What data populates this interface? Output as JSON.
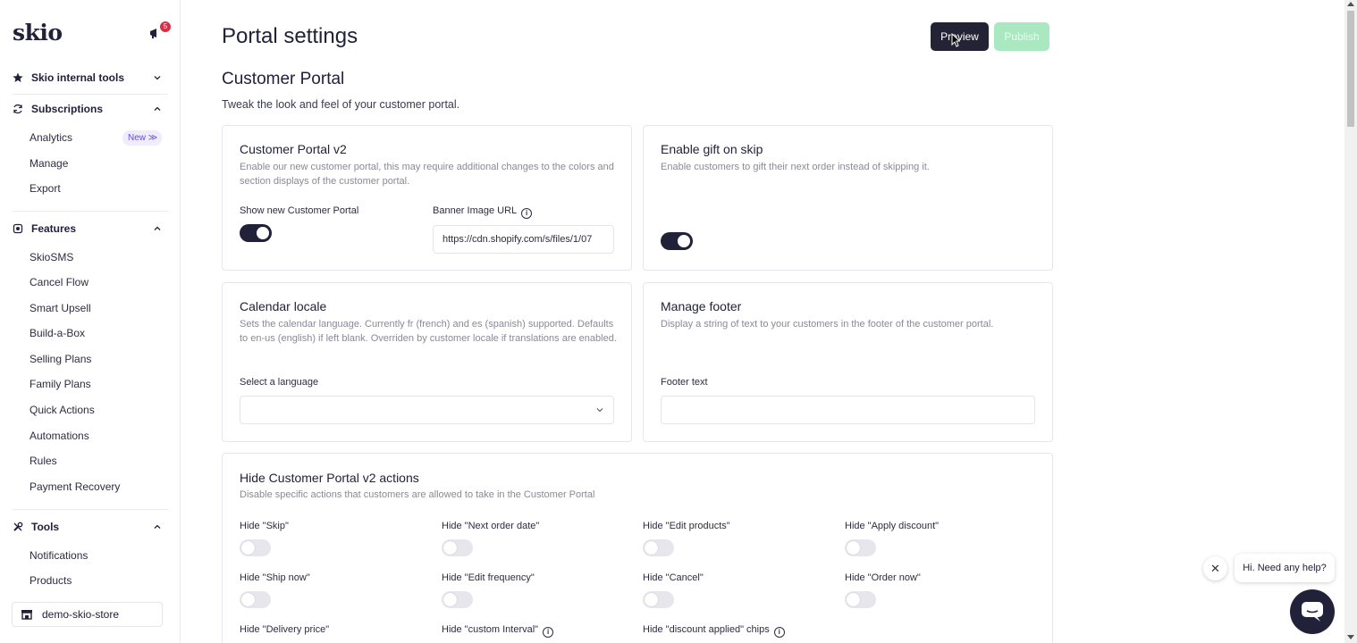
{
  "sidebar": {
    "logo": "skio",
    "notification_count": "5",
    "sections": [
      {
        "label": "Skio internal tools",
        "icon": "star-icon"
      },
      {
        "label": "Subscriptions",
        "icon": "refresh-icon"
      },
      {
        "label": "Features",
        "icon": "settings-icon"
      },
      {
        "label": "Tools",
        "icon": "tools-icon"
      }
    ],
    "subscriptions_items": [
      "Analytics",
      "Manage",
      "Export"
    ],
    "analytics_badge": "New",
    "features_items": [
      "SkioSMS",
      "Cancel Flow",
      "Smart Upsell",
      "Build-a-Box",
      "Selling Plans",
      "Family Plans",
      "Quick Actions",
      "Automations",
      "Rules",
      "Payment Recovery"
    ],
    "tools_items": [
      "Notifications",
      "Products"
    ],
    "store_name": "demo-skio-store"
  },
  "header": {
    "title": "Portal settings",
    "preview_label": "Preview",
    "publish_label": "Publish"
  },
  "portal": {
    "heading": "Customer Portal",
    "subheading": "Tweak the look and feel of your customer portal."
  },
  "cards": {
    "portal_v2": {
      "title": "Customer Portal v2",
      "desc": "Enable our new customer portal, this may require additional changes to the colors and section displays of the customer portal.",
      "toggle_label": "Show new Customer Portal",
      "banner_label": "Banner Image URL",
      "banner_value": "https://cdn.shopify.com/s/files/1/07"
    },
    "gift": {
      "title": "Enable gift on skip",
      "desc": "Enable customers to gift their next order instead of skipping it."
    },
    "calendar": {
      "title": "Calendar locale",
      "desc": "Sets the calendar language. Currently fr (french) and es (spanish) supported. Defaults to en-us (english) if left blank. Overriden by customer locale if translations are enabled.",
      "select_label": "Select a language",
      "select_value": ""
    },
    "footer": {
      "title": "Manage footer",
      "desc": "Display a string of text to your customers in the footer of the customer portal.",
      "field_label": "Footer text",
      "field_value": ""
    },
    "actions": {
      "title": "Hide Customer Portal v2 actions",
      "desc": "Disable specific actions that customers are allowed to take in the Customer Portal",
      "items": [
        "Hide \"Skip\"",
        "Hide \"Next order date\"",
        "Hide \"Edit products\"",
        "Hide \"Apply discount\"",
        "Hide \"Ship now\"",
        "Hide \"Edit frequency\"",
        "Hide \"Cancel\"",
        "Hide \"Order now\"",
        "Hide \"Delivery price\"",
        "Hide \"custom Interval\"",
        "Hide \"discount applied\" chips"
      ]
    }
  },
  "chat": {
    "prompt": "Hi. Need any help?"
  }
}
